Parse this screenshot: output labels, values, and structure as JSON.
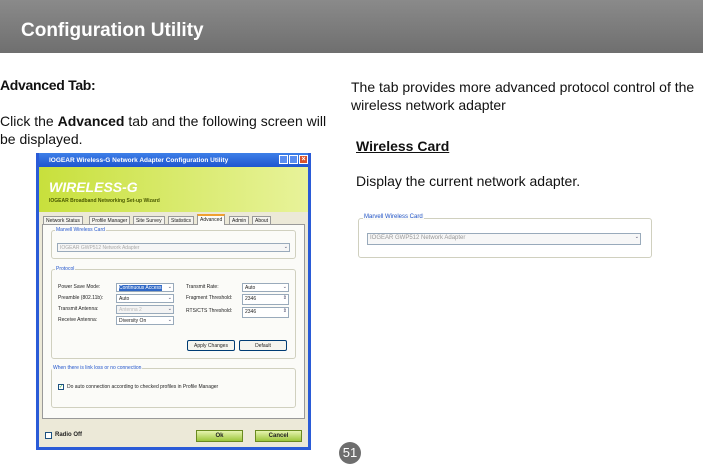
{
  "header": {
    "title": "Configuration Utility"
  },
  "left": {
    "heading": "Advanced Tab:",
    "intro_pre": "Click the ",
    "intro_bold": "Advanced",
    "intro_post": " tab and the following screen will be displayed."
  },
  "right": {
    "desc": "The tab provides more advanced protocol control of the wireless network adapter",
    "section_title": "Wireless Card",
    "section_desc": "Display the current network adapter."
  },
  "card_snippet": {
    "legend": "Marvell Wireless Card",
    "adapter": "IOGEAR GWP512 Network Adapter"
  },
  "window": {
    "title": "IOGEAR Wireless-G Network Adapter Configuration Utility",
    "logo": "WIRELESS-G",
    "subtitle": "IOGEAR Broadband Networking Set-up Wizard",
    "tabs": [
      "Network Status",
      "Profile Manager",
      "Site Survey",
      "Statistics",
      "Advanced",
      "Admin",
      "About"
    ],
    "active_tab": "Advanced",
    "card_legend": "Marvell Wireless Card",
    "adapter": "IOGEAR GWP512 Network Adapter",
    "protocol_legend": "Protocol",
    "fields": {
      "power_save_label": "Power Save Mode:",
      "power_save": "Continuous Access",
      "preamble_label": "Preamble (802.11b):",
      "preamble": "Auto",
      "tx_ant_label": "Transmit Antenna:",
      "tx_ant": "Antenna 2",
      "rx_ant_label": "Receive Antenna:",
      "rx_ant": "Diversity On",
      "tx_rate_label": "Transmit Rate:",
      "tx_rate": "Auto",
      "frag_label": "Fragment Threshold:",
      "frag": "2346",
      "rts_label": "RTS/CTS Threshold:",
      "rts": "2346"
    },
    "apply": "Apply Changes",
    "default": "Default",
    "linkloss_legend": "When there is link loss or no connection",
    "auto_conn": "Do auto connection according to checked profiles in Profile Manager",
    "radio_off": "Radio Off",
    "ok": "Ok",
    "cancel": "Cancel"
  },
  "page_number": "51"
}
